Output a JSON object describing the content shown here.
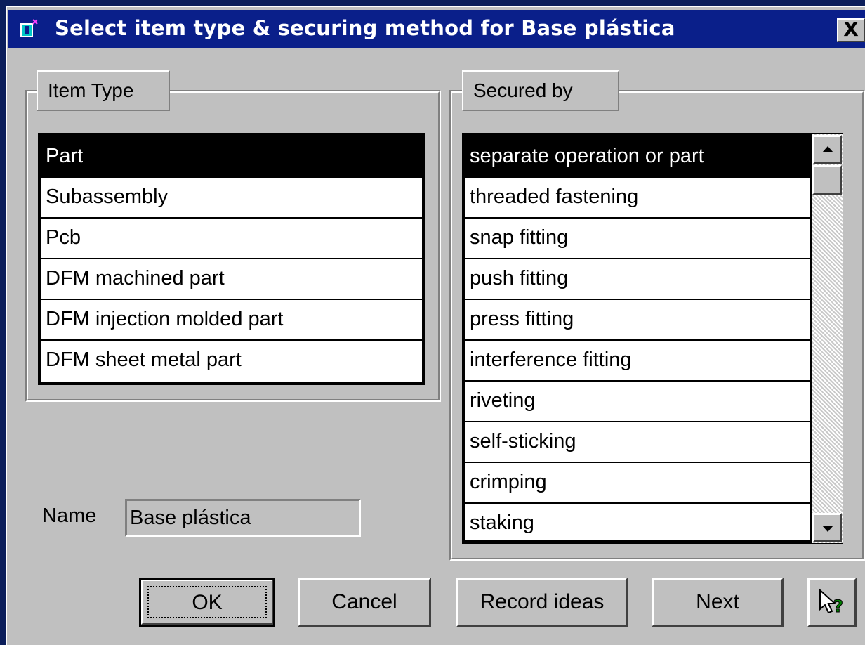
{
  "window": {
    "title": "Select item type & securing method for Base plástica",
    "close_label": "X"
  },
  "item_type": {
    "label": "Item Type",
    "items": [
      "Part",
      "Subassembly",
      "Pcb",
      "DFM machined part",
      "DFM injection molded part",
      "DFM sheet metal part"
    ],
    "selected": "Part"
  },
  "secured_by": {
    "label": "Secured by",
    "items": [
      "separate operation or part",
      "threaded fastening",
      "snap fitting",
      "push fitting",
      "press fitting",
      "interference fitting",
      "riveting",
      "self-sticking",
      "crimping",
      "staking"
    ],
    "selected": "separate operation or part"
  },
  "name": {
    "label": "Name",
    "value": "Base plástica"
  },
  "buttons": {
    "ok": "OK",
    "cancel": "Cancel",
    "record_ideas": "Record ideas",
    "next": "Next"
  },
  "colors": {
    "title_bar": "#0a1f8a",
    "dialog_face": "#c0c0c0",
    "selection": "#000000",
    "desktop": "#0b1e5b"
  }
}
